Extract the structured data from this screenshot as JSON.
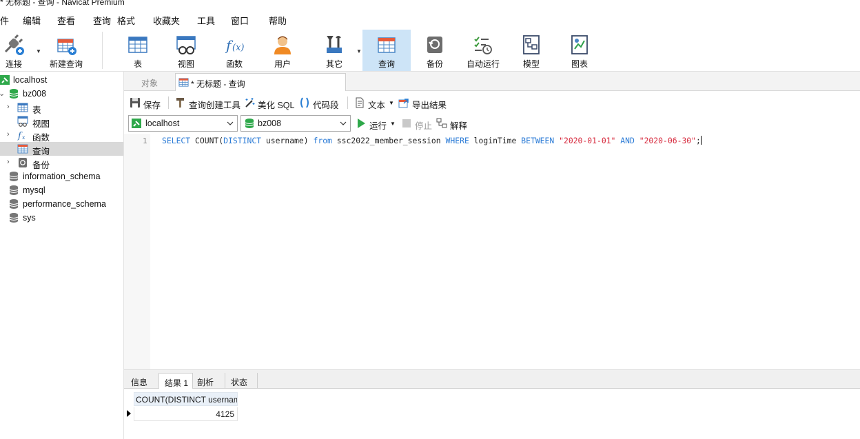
{
  "window": {
    "title": "* 无标题 - 查询 - Navicat Premium"
  },
  "menu": [
    "件",
    "编辑",
    "查看",
    "查询",
    "格式",
    "收藏夹",
    "工具",
    "窗口",
    "帮助"
  ],
  "toolbar": {
    "connect": "连接",
    "new_query": "新建查询",
    "table": "表",
    "view": "视图",
    "function": "函数",
    "user": "用户",
    "other": "其它",
    "query": "查询",
    "backup": "备份",
    "automation": "自动运行",
    "model": "模型",
    "chart": "图表"
  },
  "sidebar": {
    "items": [
      {
        "label": "localhost",
        "icon": "connection-icon"
      },
      {
        "label": "bz008",
        "icon": "database-icon"
      },
      {
        "label": "表",
        "icon": "table-icon"
      },
      {
        "label": "视图",
        "icon": "view-icon"
      },
      {
        "label": "函数",
        "icon": "function-icon"
      },
      {
        "label": "查询",
        "icon": "query-icon"
      },
      {
        "label": "备份",
        "icon": "backup-icon"
      },
      {
        "label": "information_schema",
        "icon": "database-icon"
      },
      {
        "label": "mysql",
        "icon": "database-icon"
      },
      {
        "label": "performance_schema",
        "icon": "database-icon"
      },
      {
        "label": "sys",
        "icon": "database-icon"
      }
    ]
  },
  "tabs": {
    "objects": "对象",
    "query": "* 无标题 - 查询"
  },
  "query_toolbar": {
    "save": "保存",
    "query_builder": "查询创建工具",
    "beautify": "美化 SQL",
    "code_snippet": "代码段",
    "text": "文本",
    "export": "导出结果"
  },
  "connection_bar": {
    "connection": "localhost",
    "database": "bz008",
    "run": "运行",
    "stop": "停止",
    "explain": "解释"
  },
  "editor": {
    "line_number": "1",
    "tokens": {
      "select": "SELECT",
      "count": " COUNT(",
      "distinct": "DISTINCT",
      "username": " username) ",
      "from": "from",
      "table": " ssc2022_member_session ",
      "where": "WHERE",
      "column": " loginTime ",
      "between": "BETWEEN",
      "sp1": " ",
      "date1": "\"2020-01-01\"",
      "sp2": " ",
      "and": "AND",
      "sp3": " ",
      "date2": "\"2020-06-30\"",
      "semicolon": ";"
    }
  },
  "results": {
    "tabs": [
      "信息",
      "结果 1",
      "剖析",
      "状态"
    ],
    "active_tab": "结果 1",
    "columns": [
      "COUNT(DISTINCT username)"
    ],
    "rows": [
      [
        "4125"
      ]
    ]
  }
}
